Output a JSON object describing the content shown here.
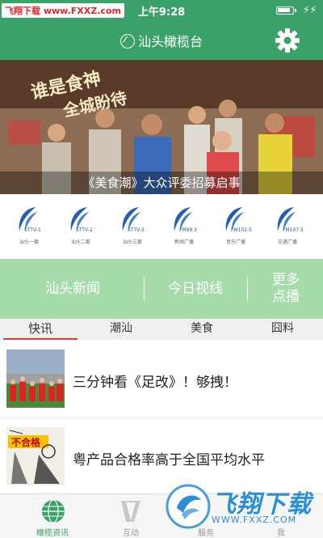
{
  "status_bar": {
    "watermark": "飞翔下载 www.FXXZ.com",
    "time": "上午9:28",
    "charge_symbol": "⚡⚡"
  },
  "header": {
    "title": "汕头橄榄台",
    "logo_icon": "leaf-icon",
    "settings_icon": "gear-icon"
  },
  "banner": {
    "caption": "《美食潮》大众评委招募启事",
    "calligraphy_line1": "谁是食神",
    "calligraphy_line2": "全城盼待"
  },
  "channels": [
    {
      "code": "STTV-1",
      "name": "汕头一套"
    },
    {
      "code": "STTV-2",
      "name": "汕头二套"
    },
    {
      "code": "STTV-3",
      "name": "汕头三套"
    },
    {
      "code": "FM99.3",
      "name": "新闻广播"
    },
    {
      "code": "FM102.5",
      "name": "音乐广播"
    },
    {
      "code": "FM107.5",
      "name": "交通广播"
    }
  ],
  "green_nav": {
    "news": "汕头新闻",
    "today": "今日视线",
    "more_line1": "更多",
    "more_line2": "点播"
  },
  "tabs": [
    "快讯",
    "潮汕",
    "美食",
    "囧料"
  ],
  "active_tab": 0,
  "news": [
    {
      "title": "三分钟看《足改》！够拽！"
    },
    {
      "title": "粤产品合格率高于全国平均水平",
      "thumb_text": "不合格"
    }
  ],
  "bottom_nav": [
    {
      "label": "橄榄资讯",
      "icon": "globe-icon"
    },
    {
      "label": "互动",
      "icon": "interaction-icon"
    },
    {
      "label": "服务",
      "icon": "service-icon"
    },
    {
      "label": "我",
      "icon": "profile-icon"
    }
  ],
  "watermark": {
    "brand": "飞翔下载",
    "url": "WWW.FXXZ.COM"
  },
  "colors": {
    "primary_green": "#3aa268",
    "light_green": "#a6dca9",
    "accent_red": "#e53935",
    "channel_blue": "#1f5fb4"
  }
}
